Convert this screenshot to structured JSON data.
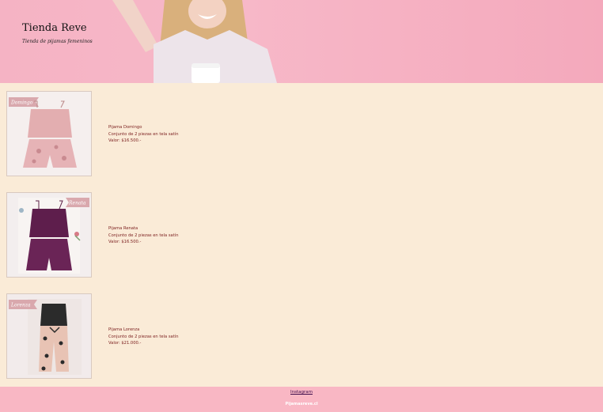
{
  "header": {
    "title": "Tienda Reve",
    "tagline": "Tienda de pijamas femeninos"
  },
  "products": [
    {
      "badge": "Domingo",
      "name": "Pijama Domingo",
      "description": "Conjunto de 2 piezas en tela satín",
      "price": "Valor: $16.500.-"
    },
    {
      "badge": "Renata",
      "name": "Pijama Renata",
      "description": "Conjunto de 2 piezas en tela satín",
      "price": "Valor: $16.500.-"
    },
    {
      "badge": "Lorenza",
      "name": "Pijama Lorenza",
      "description": "Conjunto de 2 piezas en tela satín",
      "price": "Valor: $21.000.-"
    }
  ],
  "footer": {
    "instagram_link": "Instagram",
    "note": "Pijamasreve.cl"
  },
  "colors": {
    "header_pink": "#f5b3c4",
    "content_bg": "#faebd7",
    "footer_pink": "#f9b7c4",
    "product_text": "#7a1d1d"
  }
}
